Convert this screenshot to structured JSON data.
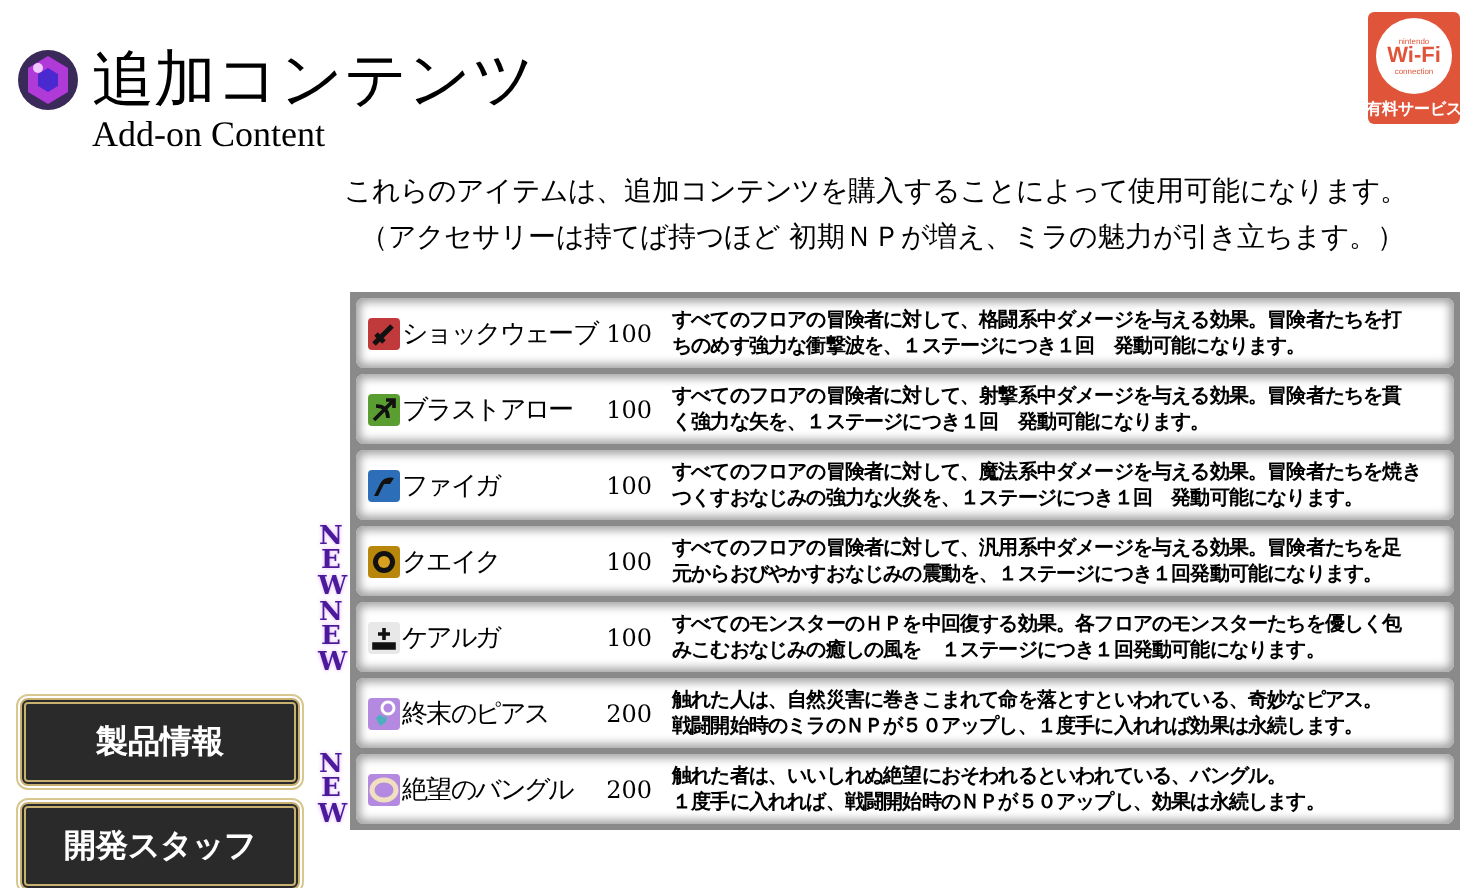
{
  "header": {
    "title": "追加コンテンツ",
    "subtitle": "Add-on Content"
  },
  "badge": {
    "top": "nintendo",
    "main": "Wi-Fi",
    "bottom": "connection",
    "label": "有料サービス"
  },
  "intro": [
    "これらのアイテムは、追加コンテンツを購入することによって使用可能になります。",
    "（アクセサリーは持てば持つほど 初期ＮＰが増え、ミラの魅力が引き立ちます。）"
  ],
  "items": [
    {
      "name": "ショックウェーブ",
      "price": "100",
      "description": [
        "すべてのフロアの冒険者に対して、格闘系中ダメージを与える効果。冒険者たちを打",
        "ちのめす強力な衝撃波を、１ステージにつき１回　発動可能になります。"
      ]
    },
    {
      "name": "ブラストアロー",
      "price": "100",
      "description": [
        "すべてのフロアの冒険者に対して、射撃系中ダメージを与える効果。冒険者たちを貫",
        "く強力な矢を、１ステージにつき１回　発動可能になります。"
      ]
    },
    {
      "name": "ファイガ",
      "price": "100",
      "description": [
        "すべてのフロアの冒険者に対して、魔法系中ダメージを与える効果。冒険者たちを焼き",
        "つくすおなじみの強力な火炎を、１ステージにつき１回　発動可能になります。"
      ]
    },
    {
      "name": "クエイク",
      "price": "100",
      "description": [
        "すべてのフロアの冒険者に対して、汎用系中ダメージを与える効果。冒険者たちを足",
        "元からおびやかすおなじみの震動を、１ステージにつき１回発動可能になります。"
      ],
      "new_label": "NEW"
    },
    {
      "name": "ケアルガ",
      "price": "100",
      "description": [
        "すべてのモンスターのＨＰを中回復する効果。各フロアのモンスターたちを優しく包",
        "みこむおなじみの癒しの風を　１ステージにつき１回発動可能になります。"
      ],
      "new_label": "NEW"
    },
    {
      "name": "終末のピアス",
      "price": "200",
      "description": [
        "触れた人は、自然災害に巻きこまれて命を落とすといわれている、奇妙なピアス。",
        "戦闘開始時のミラのＮＰが５０アップし、１度手に入れれば効果は永続します。"
      ]
    },
    {
      "name": "絶望のバングル",
      "price": "200",
      "description": [
        "触れた者は、いいしれぬ絶望におそわれるといわれている、バングル。",
        "１度手に入れれば、戦闘開始時のＮＰが５０アップし、効果は永続します。"
      ],
      "new_label": "NEW"
    }
  ],
  "nav": [
    "製品情報",
    "開発スタッフ"
  ]
}
